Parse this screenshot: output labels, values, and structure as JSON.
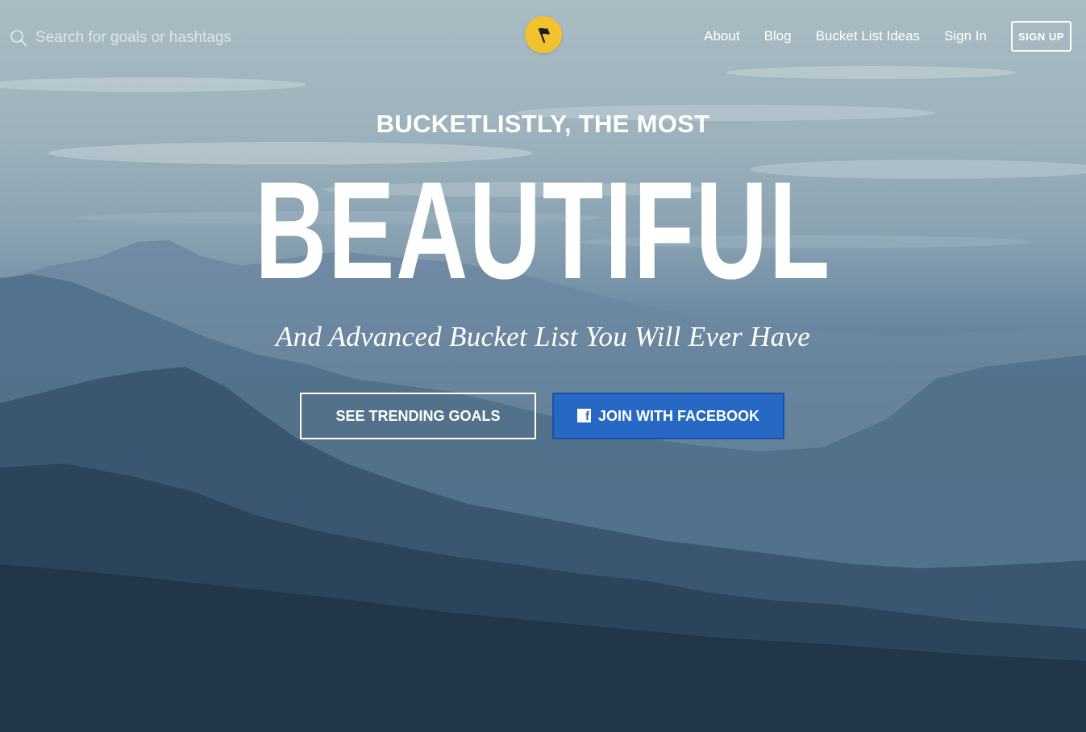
{
  "search": {
    "placeholder": "Search for goals or hashtags",
    "icon": "search-icon"
  },
  "logo": {
    "icon": "flag-icon",
    "color": "#f2c12e"
  },
  "nav": {
    "about": "About",
    "blog": "Blog",
    "ideas": "Bucket List Ideas",
    "signin": "Sign In",
    "signup": "SIGN UP"
  },
  "hero": {
    "kicker": "BUCKETLISTLY, THE MOST",
    "headline": "BEAUTIFUL",
    "tagline": "And Advanced Bucket List You Will Ever Have"
  },
  "cta": {
    "trending": "SEE TRENDING GOALS",
    "facebook": "JOIN WITH FACEBOOK",
    "facebook_icon": "facebook-icon",
    "facebook_icon_glyph": "f",
    "facebook_color": "#2768c4"
  }
}
